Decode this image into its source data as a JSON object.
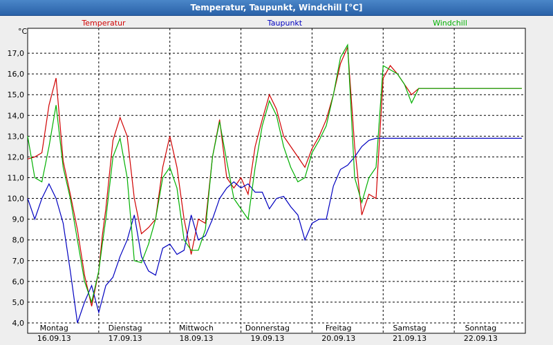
{
  "window": {
    "title": "Temperatur, Taupunkt, Windchill [°C]"
  },
  "chart_data": {
    "type": "line",
    "title": "Temperatur, Taupunkt, Windchill [°C]",
    "ylabel": "°C",
    "ylim": [
      3.5,
      18.2
    ],
    "yticks": [
      4.0,
      5.0,
      6.0,
      7.0,
      8.0,
      9.0,
      10.0,
      11.0,
      12.0,
      13.0,
      14.0,
      15.0,
      16.0,
      17.0
    ],
    "ytick_labels": [
      "4,0",
      "5,0",
      "6,0",
      "7,0",
      "8,0",
      "9,0",
      "10,0",
      "11,0",
      "12,0",
      "13,0",
      "14,0",
      "15,0",
      "16,0",
      "17,0"
    ],
    "xlim": [
      0,
      7
    ],
    "x_unit": "days since 16.09.13 00:00",
    "day_ticks": [
      {
        "day": "Montag",
        "date": "16.09.13"
      },
      {
        "day": "Dienstag",
        "date": "17.09.13"
      },
      {
        "day": "Mittwoch",
        "date": "18.09.13"
      },
      {
        "day": "Donnerstag",
        "date": "19.09.13"
      },
      {
        "day": "Freitag",
        "date": "20.09.13"
      },
      {
        "day": "Samstag",
        "date": "21.09.13"
      },
      {
        "day": "Sonntag",
        "date": "22.09.13"
      }
    ],
    "grid": true,
    "legend_position": "top",
    "series": [
      {
        "name": "Temperatur",
        "color": "#d00000",
        "x": [
          0,
          0.1,
          0.2,
          0.3,
          0.4,
          0.5,
          0.6,
          0.7,
          0.8,
          0.9,
          1.0,
          1.05,
          1.1,
          1.2,
          1.3,
          1.4,
          1.5,
          1.6,
          1.7,
          1.8,
          1.9,
          2.0,
          2.1,
          2.2,
          2.3,
          2.4,
          2.5,
          2.6,
          2.7,
          2.8,
          2.9,
          3.0,
          3.1,
          3.2,
          3.3,
          3.4,
          3.5,
          3.6,
          3.7,
          3.8,
          3.9,
          4.0,
          4.1,
          4.2,
          4.3,
          4.4,
          4.5,
          4.6,
          4.7,
          4.8,
          4.9,
          5.0,
          5.1,
          5.2,
          5.3,
          5.4,
          5.5,
          5.6,
          5.7,
          5.8,
          5.9,
          6.0,
          6.1,
          6.2,
          6.3,
          6.4,
          6.5,
          6.6,
          6.7,
          6.8,
          6.9,
          6.95
        ],
        "y": [
          11.9,
          12.0,
          12.2,
          14.5,
          15.8,
          11.8,
          10.2,
          8.5,
          6.3,
          4.8,
          6.5,
          8.2,
          9.5,
          12.8,
          13.9,
          13.0,
          10.0,
          8.3,
          8.6,
          9.0,
          11.5,
          13.0,
          11.5,
          9.0,
          7.3,
          9.0,
          8.8,
          12.0,
          13.8,
          11.0,
          10.5,
          11.0,
          10.2,
          12.5,
          13.8,
          15.0,
          14.3,
          13.0,
          12.5,
          12.0,
          11.5,
          12.4,
          13.0,
          13.8,
          15.0,
          16.5,
          17.3,
          12.5,
          9.2,
          10.2,
          10.0,
          15.8,
          16.4,
          16.0,
          15.5,
          15.0,
          15.3,
          15.3,
          15.3,
          15.3,
          15.3,
          15.3,
          15.3,
          15.3,
          15.3,
          15.3,
          15.3,
          15.3,
          15.3,
          15.3,
          15.3,
          15.3
        ]
      },
      {
        "name": "Taupunkt",
        "color": "#0000c0",
        "x": [
          0,
          0.1,
          0.2,
          0.3,
          0.4,
          0.5,
          0.6,
          0.7,
          0.8,
          0.9,
          1.0,
          1.1,
          1.2,
          1.3,
          1.4,
          1.5,
          1.6,
          1.7,
          1.8,
          1.9,
          2.0,
          2.1,
          2.2,
          2.3,
          2.4,
          2.5,
          2.6,
          2.7,
          2.8,
          2.9,
          3.0,
          3.1,
          3.2,
          3.3,
          3.4,
          3.5,
          3.6,
          3.7,
          3.8,
          3.9,
          4.0,
          4.1,
          4.2,
          4.3,
          4.4,
          4.5,
          4.6,
          4.7,
          4.8,
          4.9,
          5.0,
          5.1,
          5.2,
          5.3,
          5.4,
          5.5,
          5.6,
          5.7,
          5.8,
          5.9,
          6.0,
          6.1,
          6.2,
          6.3,
          6.4,
          6.5,
          6.6,
          6.7,
          6.8,
          6.9,
          6.95
        ],
        "y": [
          10.0,
          9.0,
          10.0,
          10.7,
          10.0,
          8.8,
          6.5,
          4.0,
          5.0,
          5.8,
          4.5,
          5.8,
          6.2,
          7.2,
          8.0,
          9.2,
          7.2,
          6.5,
          6.3,
          7.6,
          7.8,
          7.3,
          7.5,
          9.2,
          8.0,
          8.2,
          9.0,
          10.0,
          10.5,
          10.8,
          10.5,
          10.7,
          10.3,
          10.3,
          9.5,
          10.0,
          10.1,
          9.6,
          9.2,
          8.0,
          8.8,
          9.0,
          9.0,
          10.6,
          11.4,
          11.6,
          12.0,
          12.5,
          12.8,
          12.9,
          12.9,
          12.9,
          12.9,
          12.9,
          12.9,
          12.9,
          12.9,
          12.9,
          12.9,
          12.9,
          12.9,
          12.9,
          12.9,
          12.9,
          12.9,
          12.9,
          12.9,
          12.9,
          12.9,
          12.9,
          12.9
        ]
      },
      {
        "name": "Windchill",
        "color": "#00b000",
        "x": [
          0,
          0.1,
          0.2,
          0.3,
          0.4,
          0.5,
          0.6,
          0.7,
          0.8,
          0.9,
          1.0,
          1.05,
          1.1,
          1.2,
          1.3,
          1.4,
          1.5,
          1.6,
          1.7,
          1.8,
          1.9,
          2.0,
          2.1,
          2.2,
          2.3,
          2.4,
          2.5,
          2.6,
          2.7,
          2.8,
          2.9,
          3.0,
          3.1,
          3.2,
          3.3,
          3.4,
          3.5,
          3.6,
          3.7,
          3.8,
          3.9,
          4.0,
          4.1,
          4.2,
          4.3,
          4.4,
          4.5,
          4.6,
          4.7,
          4.8,
          4.9,
          5.0,
          5.1,
          5.2,
          5.3,
          5.4,
          5.5,
          5.6,
          5.7,
          5.8,
          5.9,
          6.0,
          6.1,
          6.2,
          6.3,
          6.4,
          6.5,
          6.6,
          6.7,
          6.8,
          6.9,
          6.95
        ],
        "y": [
          13.0,
          11.0,
          10.8,
          12.5,
          14.5,
          11.5,
          10.0,
          8.0,
          6.0,
          5.0,
          6.5,
          7.8,
          9.0,
          12.0,
          12.9,
          11.0,
          7.0,
          6.9,
          7.8,
          9.0,
          11.0,
          11.5,
          10.5,
          8.0,
          7.5,
          7.5,
          8.5,
          12.0,
          13.7,
          11.8,
          10.0,
          9.5,
          9.0,
          11.5,
          13.5,
          14.7,
          14.0,
          12.5,
          11.5,
          10.8,
          11.0,
          12.2,
          12.8,
          13.5,
          15.0,
          16.8,
          17.4,
          11.0,
          9.8,
          11.0,
          11.5,
          16.4,
          16.2,
          16.0,
          15.5,
          14.6,
          15.3,
          15.3,
          15.3,
          15.3,
          15.3,
          15.3,
          15.3,
          15.3,
          15.3,
          15.3,
          15.3,
          15.3,
          15.3,
          15.3,
          15.3,
          15.3
        ]
      }
    ]
  }
}
